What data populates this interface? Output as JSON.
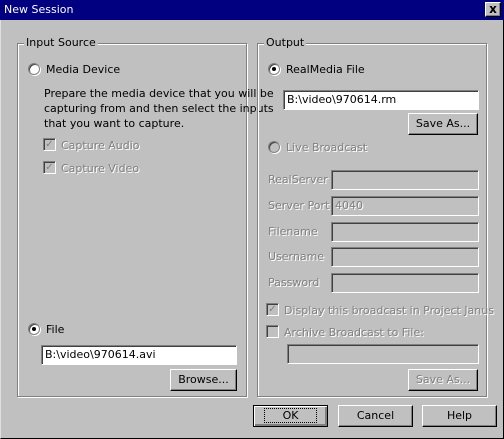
{
  "window": {
    "title": "New Session",
    "close_glyph": "x"
  },
  "input_source": {
    "title": "Input Source",
    "media_device": {
      "label": "Media Device",
      "selected": false,
      "description_lines": [
        "Prepare the media device that you will be",
        "capturing from and then select the inputs",
        "that you want to capture."
      ],
      "capture_audio": {
        "label": "Capture Audio",
        "checked": true,
        "enabled": false
      },
      "capture_video": {
        "label": "Capture Video",
        "checked": true,
        "enabled": false
      }
    },
    "file": {
      "label": "File",
      "selected": true,
      "path": "B:\\video\\970614.avi",
      "browse_label": "Browse..."
    }
  },
  "output": {
    "title": "Output",
    "realmedia_file": {
      "label": "RealMedia File",
      "selected": true,
      "path": "B:\\video\\970614.rm",
      "save_as_label": "Save As..."
    },
    "live_broadcast": {
      "label": "Live Broadcast",
      "selected": false,
      "enabled": false,
      "realserver_label": "RealServer",
      "realserver_value": "",
      "server_port_label": "Server Port",
      "server_port_value": "4040",
      "filename_label": "Filename",
      "filename_value": "",
      "username_label": "Username",
      "username_value": "",
      "password_label": "Password",
      "password_value": "",
      "display_in_janus": {
        "label": "Display this broadcast in Project Janus",
        "checked": true,
        "enabled": false
      },
      "archive_to_file": {
        "label": "Archive Broadcast to File:",
        "checked": false,
        "enabled": false
      },
      "archive_path": "",
      "archive_save_as_label": "Save As..."
    }
  },
  "buttons": {
    "ok": "OK",
    "cancel": "Cancel",
    "help": "Help"
  }
}
